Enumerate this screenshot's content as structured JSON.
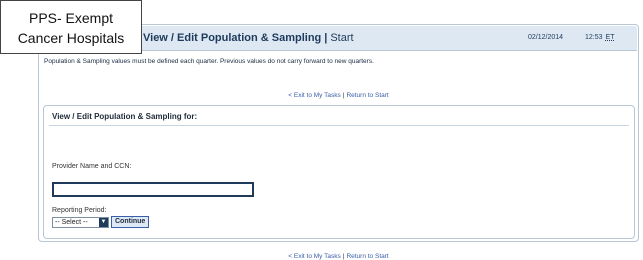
{
  "callout": {
    "line1": "PPS- Exempt",
    "line2": "Cancer Hospitals"
  },
  "header": {
    "title": "View / Edit Population & Sampling",
    "separator": "|",
    "subtitle": "Start",
    "date": "02/12/2014",
    "time": "12:53",
    "timezone": "ET"
  },
  "info": {
    "text": "Population & Sampling values must be defined each quarter. Previous values do not carry forward to new quarters."
  },
  "nav": {
    "exit_label": "< Exit to My Tasks",
    "separator": "|",
    "return_label": "Return to Start"
  },
  "form": {
    "heading": "View / Edit Population & Sampling for:",
    "provider_label": "Provider Name and CCN:",
    "provider_value": "",
    "period_label": "Reporting Period:",
    "period_selected": "-- Select --",
    "continue_label": "Continue"
  }
}
